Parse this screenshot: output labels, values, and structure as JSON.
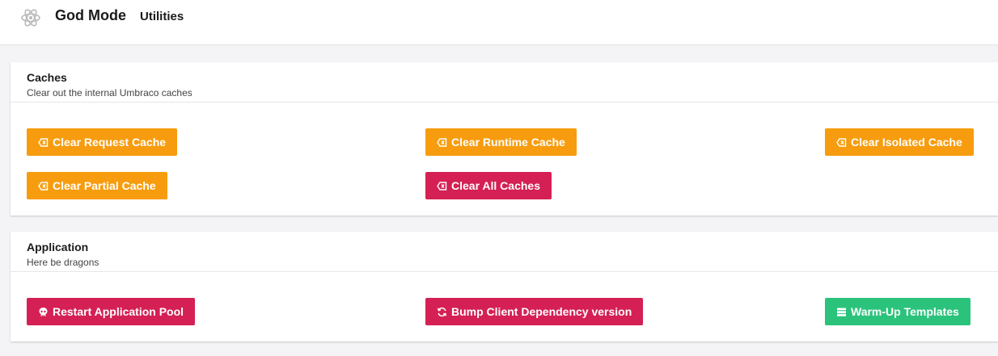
{
  "header": {
    "app_icon": "atom-icon",
    "title": "God Mode",
    "subtitle": "Utilities"
  },
  "caches_panel": {
    "title": "Caches",
    "description": "Clear out the internal Umbraco caches",
    "buttons": [
      {
        "label": "Clear Request Cache",
        "icon": "eraser-icon",
        "color": "#f79c0e"
      },
      {
        "label": "Clear Runtime Cache",
        "icon": "eraser-icon",
        "color": "#f79c0e"
      },
      {
        "label": "Clear Isolated Cache",
        "icon": "eraser-icon",
        "color": "#f79c0e"
      },
      {
        "label": "Clear Partial Cache",
        "icon": "eraser-icon",
        "color": "#f79c0e"
      },
      {
        "label": "Clear All Caches",
        "icon": "eraser-icon",
        "color": "#d42054"
      }
    ]
  },
  "application_panel": {
    "title": "Application",
    "description": "Here be dragons",
    "buttons": [
      {
        "label": "Restart Application Pool",
        "icon": "skull-icon",
        "color": "#d42054"
      },
      {
        "label": "Bump Client Dependency version",
        "icon": "refresh-icon",
        "color": "#d42054"
      },
      {
        "label": "Warm-Up Templates",
        "icon": "server-icon",
        "color": "#2bc37c"
      }
    ]
  }
}
